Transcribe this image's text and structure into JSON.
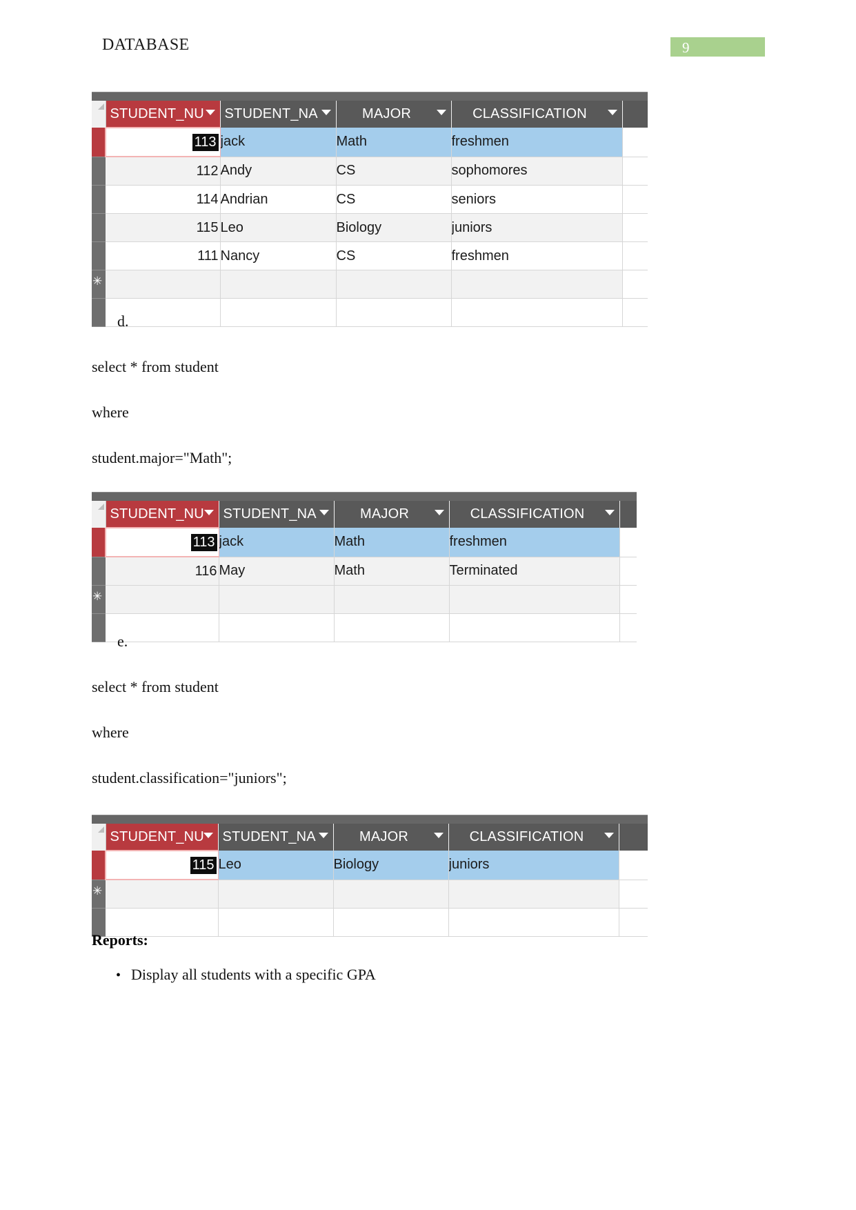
{
  "header": {
    "title": "DATABASE",
    "page_number": "9",
    "badge_color": "#a9d18e"
  },
  "theme": {
    "header_selected_color": "#b83a3f",
    "header_color": "#595959",
    "selected_row_color": "#a4cdec",
    "focus_cell_color": "#0d0d0d"
  },
  "columns": [
    "STUDENT_NU",
    "STUDENT_NA",
    "MAJOR",
    "CLASSIFICATION"
  ],
  "table_1": {
    "columns": [
      "STUDENT_NU",
      "STUDENT_NA",
      "MAJOR",
      "CLASSIFICATION"
    ],
    "rows": [
      {
        "student_number": "113",
        "student_name": "jack",
        "major": "Math",
        "classification": "freshmen",
        "selected": true
      },
      {
        "student_number": "112",
        "student_name": "Andy",
        "major": "CS",
        "classification": "sophomores",
        "selected": false
      },
      {
        "student_number": "114",
        "student_name": "Andrian",
        "major": "CS",
        "classification": "seniors",
        "selected": false
      },
      {
        "student_number": "115",
        "student_name": "Leo",
        "major": "Biology",
        "classification": "juniors",
        "selected": false
      },
      {
        "student_number": "111",
        "student_name": "Nancy",
        "major": "CS",
        "classification": "freshmen",
        "selected": false
      }
    ],
    "new_record_marker": "✳"
  },
  "table_2": {
    "columns": [
      "STUDENT_NU",
      "STUDENT_NA",
      "MAJOR",
      "CLASSIFICATION"
    ],
    "rows": [
      {
        "student_number": "113",
        "student_name": "jack",
        "major": "Math",
        "classification": "freshmen",
        "selected": true
      },
      {
        "student_number": "116",
        "student_name": "May",
        "major": "Math",
        "classification": "Terminated",
        "selected": false
      }
    ],
    "new_record_marker": "✳"
  },
  "table_3": {
    "columns": [
      "STUDENT_NU",
      "STUDENT_NA",
      "MAJOR",
      "CLASSIFICATION"
    ],
    "rows": [
      {
        "student_number": "115",
        "student_name": "Leo",
        "major": "Biology",
        "classification": "juniors",
        "selected": true
      }
    ],
    "new_record_marker": "✳"
  },
  "sections": {
    "item_d": {
      "letter": "d.",
      "line_1": "select * from student",
      "line_2": "where",
      "line_3": "student.major=\"Math\";"
    },
    "item_e": {
      "letter": "e.",
      "line_1": "select * from student",
      "line_2": "where",
      "line_3": "student.classification=\"juniors\";"
    }
  },
  "reports": {
    "heading": "Reports:",
    "bullets": [
      {
        "marker": "•",
        "text": "Display all students with a specific GPA"
      }
    ]
  }
}
